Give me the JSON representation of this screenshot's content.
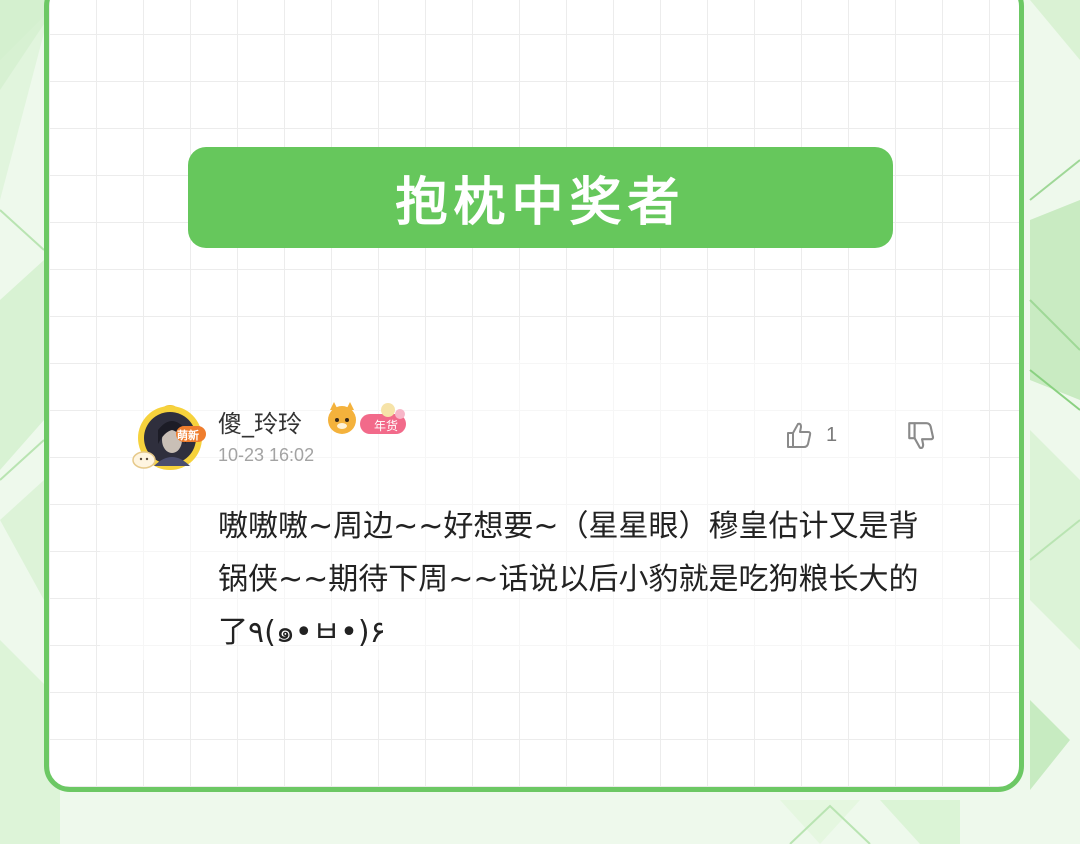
{
  "title": "抱枕中奖者",
  "comment": {
    "username": "傻_玲玲",
    "avatar_badge": "萌新",
    "user_badge": "年货",
    "timestamp": "10-23 16:02",
    "like_count": "1",
    "text": "嗷嗷嗷~周边~~好想要~（星星眼）穆皇估计又是背锅侠~~期待下周~~话说以后小豹就是吃狗粮长大的了٩(๑•ㅂ•)۶"
  },
  "icons": {
    "like": "thumbs-up-icon",
    "dislike": "thumbs-down-icon"
  },
  "colors": {
    "accent": "#66c75c",
    "border": "#6cc864",
    "background": "#eef9ec"
  }
}
